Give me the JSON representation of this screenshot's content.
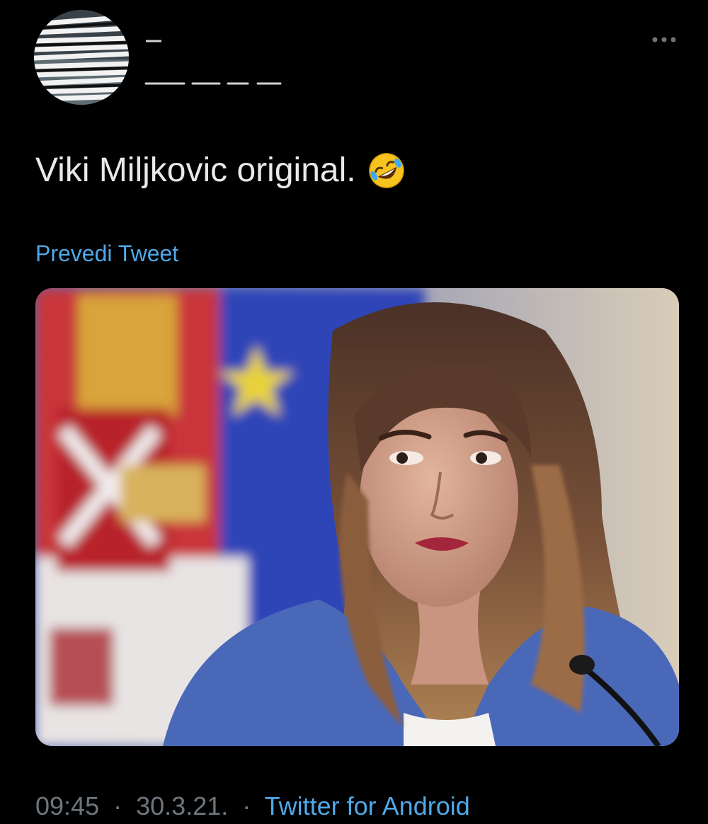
{
  "tweet": {
    "text": "Viki Miljkovic original.",
    "emoji": "rolling-on-the-floor-laughing",
    "translate_label": "Prevedi Tweet",
    "time": "09:45",
    "date": "30.3.21.",
    "separator": "·",
    "source": "Twitter for Android"
  },
  "colors": {
    "background": "#000000",
    "text": "#e7e9ea",
    "link": "#4fa8e8",
    "meta": "#6e767d"
  },
  "icons": {
    "more": "more-horizontal-icon",
    "emoji": "rofl-emoji-icon"
  }
}
